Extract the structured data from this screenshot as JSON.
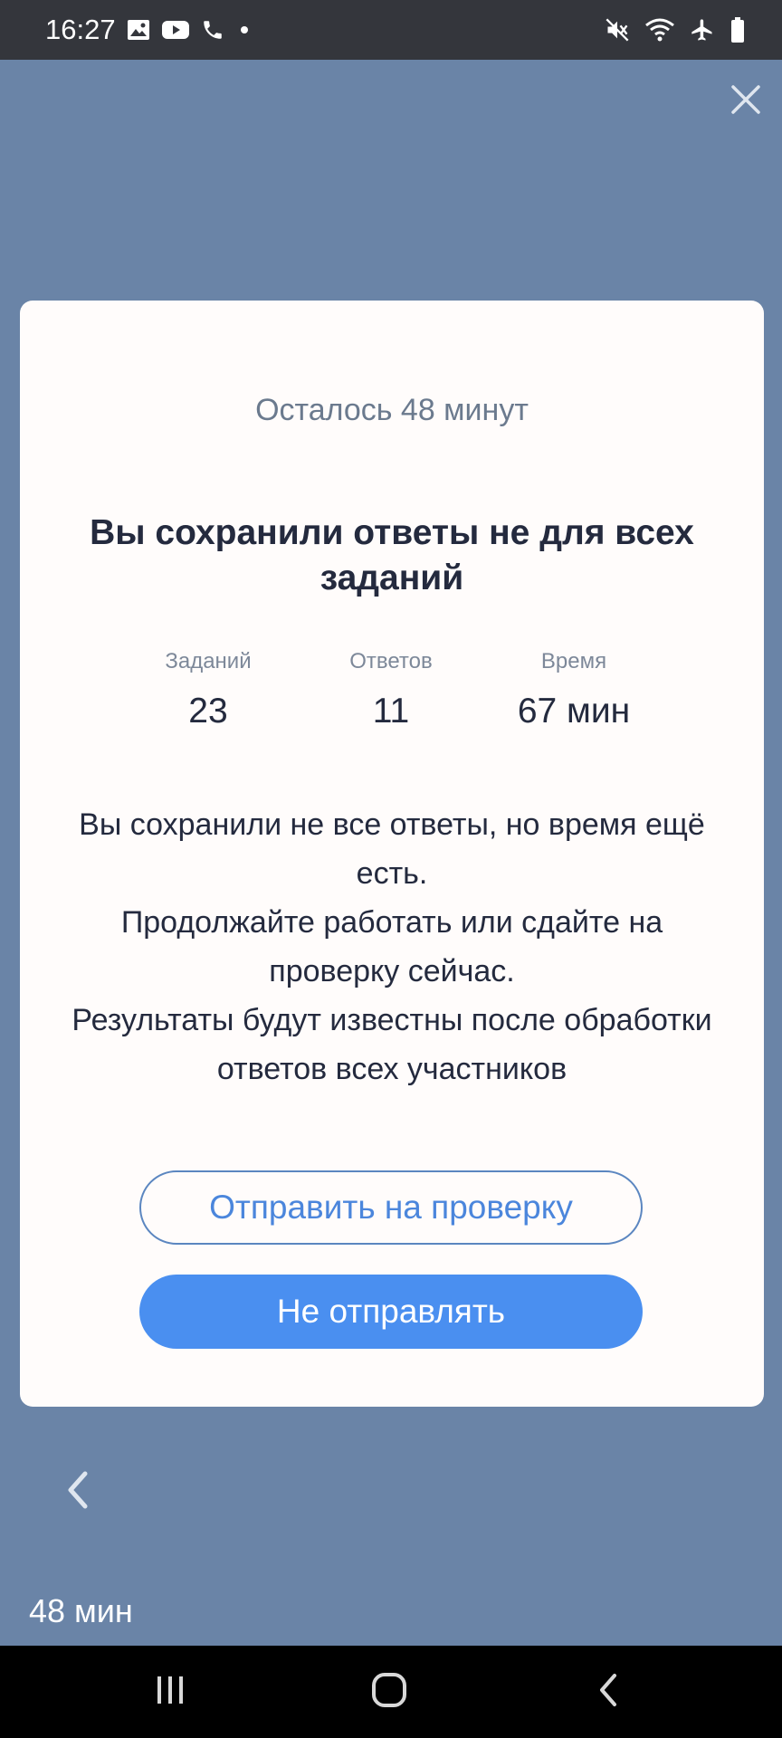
{
  "status_bar": {
    "time": "16:27",
    "left_icons": [
      "image-icon",
      "youtube-icon",
      "phone-icon",
      "dot-icon"
    ],
    "right_icons": [
      "mute-icon",
      "wifi-icon",
      "airplane-icon",
      "battery-icon"
    ]
  },
  "modal": {
    "remaining_text": "Осталось 48 минут",
    "heading": "Вы сохранили ответы не для всех заданий",
    "stats": [
      {
        "label": "Заданий",
        "value": "23"
      },
      {
        "label": "Ответов",
        "value": "11"
      },
      {
        "label": "Время",
        "value": "67 мин"
      }
    ],
    "message_lines": [
      "Вы сохранили не все ответы, но время ещё есть.",
      "Продолжайте работать или сдайте на проверку сейчас.",
      "Результаты будут известны после обработки ответов всех участников"
    ],
    "submit_label": "Отправить на проверку",
    "dont_submit_label": "Не отправлять"
  },
  "footer": {
    "timer": "48 мин"
  },
  "colors": {
    "backdrop": "#6a84a7",
    "accent": "#4a8ff0",
    "modal_bg": "#fffcfb",
    "heading_text": "#242a3e"
  }
}
